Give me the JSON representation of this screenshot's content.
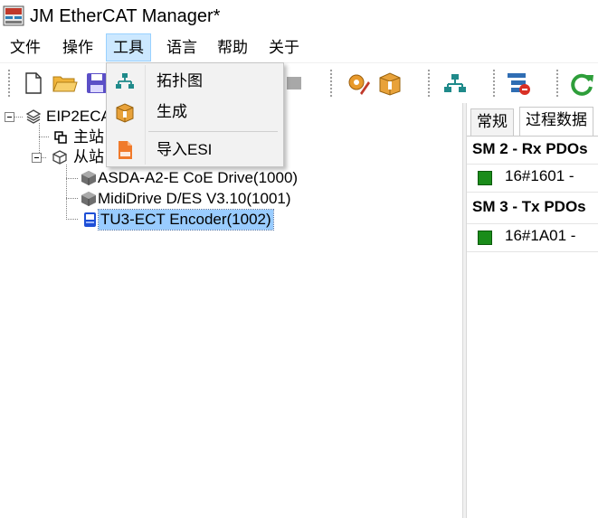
{
  "window": {
    "title": "JM EtherCAT Manager*",
    "icon": "app-logo-icon"
  },
  "menu": {
    "items": [
      {
        "label": "文件"
      },
      {
        "label": "操作"
      },
      {
        "label": "工具"
      },
      {
        "label": "语言"
      },
      {
        "label": "帮助"
      },
      {
        "label": "关于"
      }
    ],
    "active": "工具"
  },
  "tools_menu": {
    "items": [
      {
        "label": "拓扑图",
        "icon": "topology-icon"
      },
      {
        "label": "生成",
        "icon": "package-icon"
      },
      {
        "label": "导入ESI",
        "icon": "esi-file-icon"
      }
    ]
  },
  "toolbar": {
    "buttons": [
      "new-file-icon",
      "open-folder-icon",
      "save-icon",
      "gray-block-icon",
      "settings-edit-icon",
      "package-icon",
      "topology-icon",
      "network-config-icon",
      "refresh-icon"
    ]
  },
  "tree": {
    "root": "EIP2ECA",
    "master": "主站",
    "slaves_group": "从站",
    "slaves": [
      {
        "label": "ASDA-A2-E CoE Drive(1000)",
        "icon": "drive-cube-icon"
      },
      {
        "label": "MidiDrive D/ES V3.10(1001)",
        "icon": "drive-cube-icon"
      },
      {
        "label": "TU3-ECT Encoder(1002)",
        "icon": "encoder-icon",
        "selected": true
      }
    ]
  },
  "right_panel": {
    "tabs": [
      {
        "label": "常规"
      },
      {
        "label": "过程数据",
        "active": true
      }
    ],
    "sections": [
      {
        "header": "SM 2 - Rx PDOs",
        "pdos": [
          {
            "text": "16#1601  -",
            "checked": true
          }
        ]
      },
      {
        "header": "SM 3 - Tx PDOs",
        "pdos": [
          {
            "text": "16#1A01  -",
            "checked": true
          }
        ]
      }
    ]
  },
  "colors": {
    "selection": "#99ccff",
    "menu_active": "#cce8ff",
    "pdo_check": "#1a8c1a"
  }
}
